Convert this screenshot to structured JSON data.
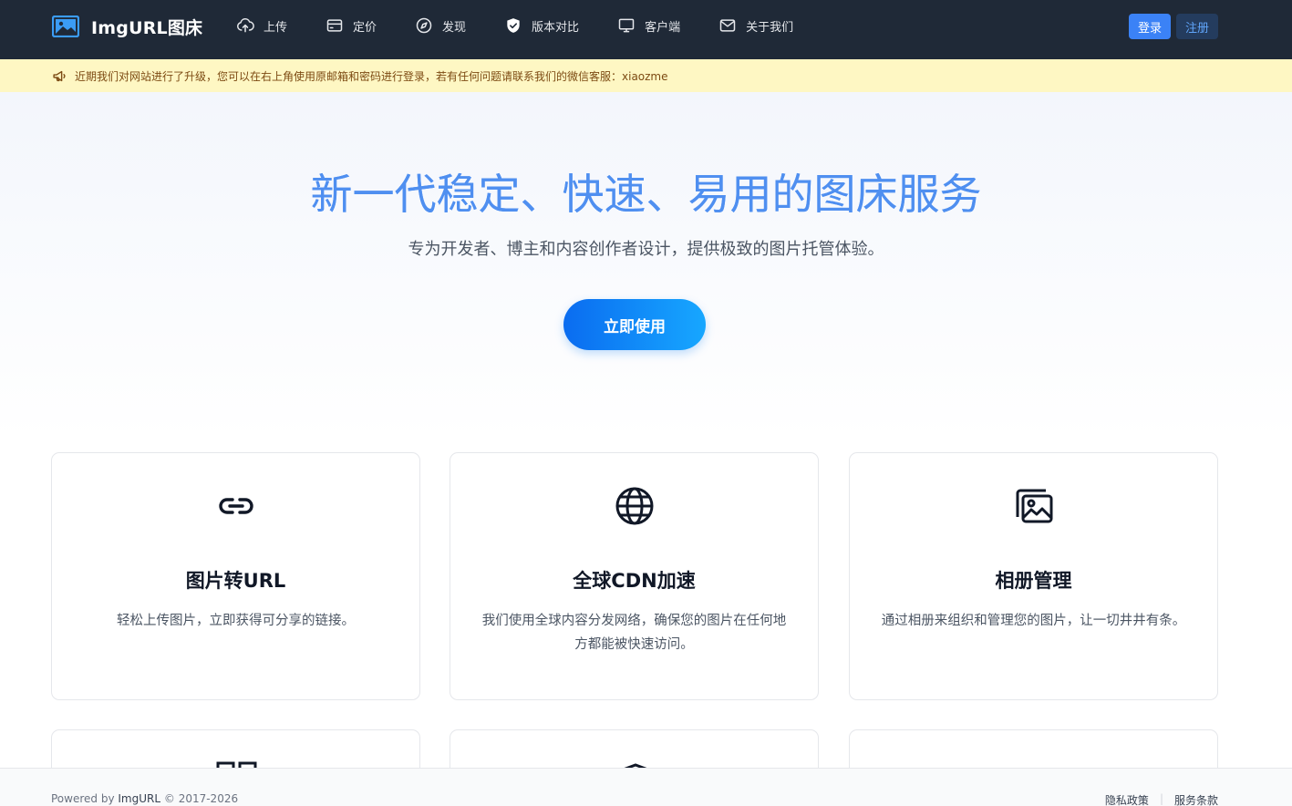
{
  "brand": {
    "name": "ImgURL图床",
    "logo_icon": "image-logo-icon"
  },
  "nav": {
    "items": [
      {
        "label": "上传",
        "icon": "cloud-upload-icon"
      },
      {
        "label": "定价",
        "icon": "credit-card-icon"
      },
      {
        "label": "发现",
        "icon": "compass-icon"
      },
      {
        "label": "版本对比",
        "icon": "shield-check-icon"
      },
      {
        "label": "客户端",
        "icon": "monitor-icon"
      },
      {
        "label": "关于我们",
        "icon": "mail-icon"
      }
    ],
    "login_label": "登录",
    "register_label": "注册"
  },
  "notice": {
    "icon": "megaphone-icon",
    "text": "近期我们对网站进行了升级，您可以在右上角使用原邮箱和密码进行登录，若有任何问题请联系我们的微信客服：xiaozme"
  },
  "hero": {
    "title": "新一代稳定、快速、易用的图床服务",
    "subtitle": "专为开发者、博主和内容创作者设计，提供极致的图片托管体验。",
    "cta_label": "立即使用"
  },
  "features": [
    {
      "icon": "link-icon",
      "title": "图片转URL",
      "desc": "轻松上传图片，立即获得可分享的链接。"
    },
    {
      "icon": "globe-icon",
      "title": "全球CDN加速",
      "desc": "我们使用全球内容分发网络，确保您的图片在任何地方都能被快速访问。"
    },
    {
      "icon": "images-icon",
      "title": "相册管理",
      "desc": "通过相册来组织和管理您的图片，让一切井井有条。"
    }
  ],
  "footer": {
    "powered_prefix": "Powered by",
    "powered_brand": "ImgURL",
    "copyright": "© 2017-2026",
    "links": [
      "隐私政策",
      "服务条款"
    ]
  },
  "colors": {
    "navbar_bg": "#1f2937",
    "accent": "#3b82f6",
    "notice_bg": "#fef7c3",
    "hero_title": "#4f8ff0"
  }
}
